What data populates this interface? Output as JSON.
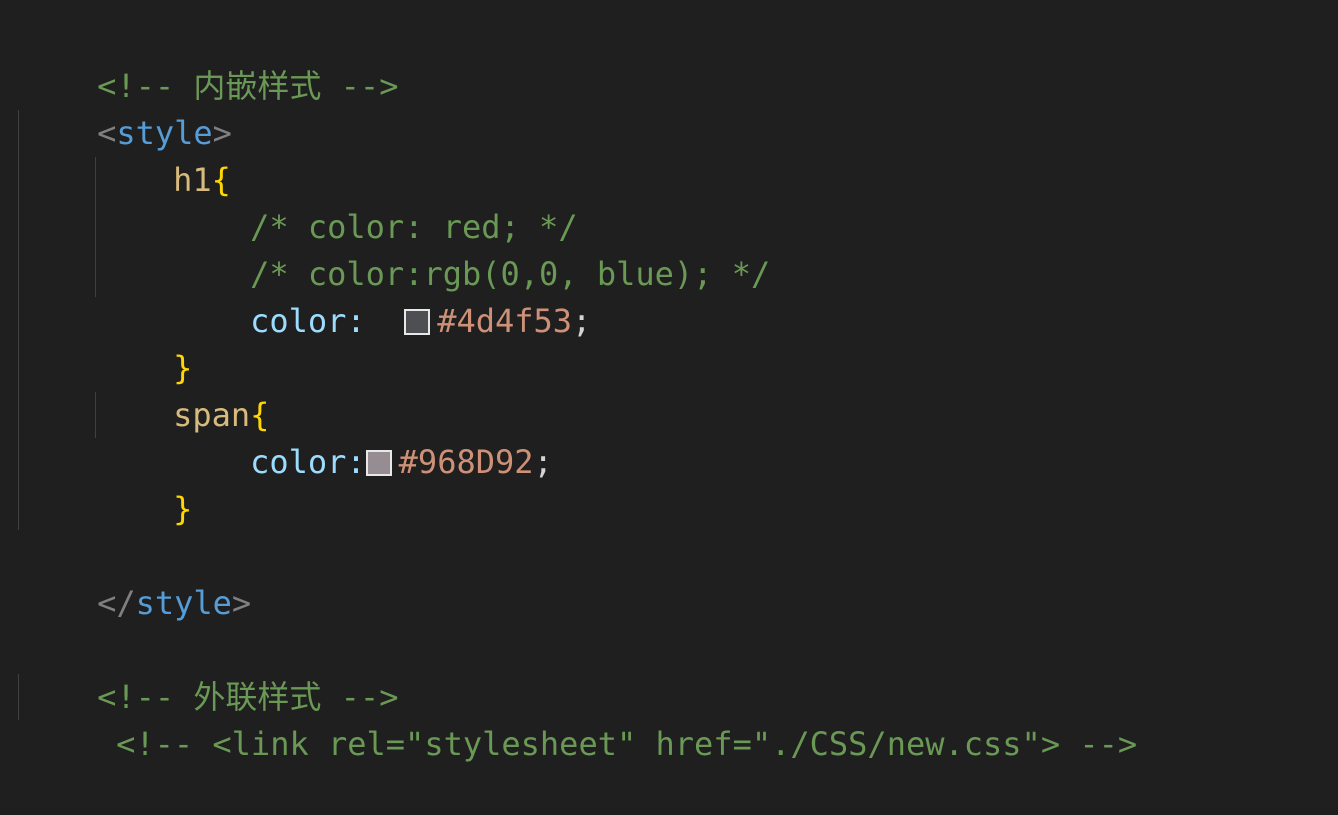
{
  "lines": [
    {
      "comment": "<!-- 内嵌样式 -->"
    },
    {
      "open": "<",
      "tag": "style",
      "close": ">"
    },
    {
      "selector": "h1",
      "brace": "{"
    },
    {
      "comment": "/* color: red; */"
    },
    {
      "comment": "/* color:rgb(0,0, blue); */"
    },
    {
      "prop": "color:",
      "value": "#4d4f53",
      "semi": ";"
    },
    {
      "brace": "}"
    },
    {
      "selector": "span",
      "brace": "{"
    },
    {
      "prop": "color:",
      "value": "#968D92",
      "semi": ";"
    },
    {
      "brace": "}"
    },
    {},
    {
      "open": "</",
      "tag": "style",
      "close": ">"
    },
    {},
    {
      "comment": "<!-- 外联样式 -->"
    },
    {
      "comment": "<!-- <link rel=\"stylesheet\" href=\"./CSS/new.css\"> -->"
    }
  ],
  "swatches": {
    "h1_color": "#4d4f53",
    "span_color": "#968D92"
  },
  "theme": {
    "background": "#1f1f1f",
    "comment": "#6a9955",
    "tag": "#569cd6",
    "selector": "#d7ba7d",
    "brace": "#ffd700",
    "property": "#9cdcfe",
    "value": "#ce9178"
  }
}
